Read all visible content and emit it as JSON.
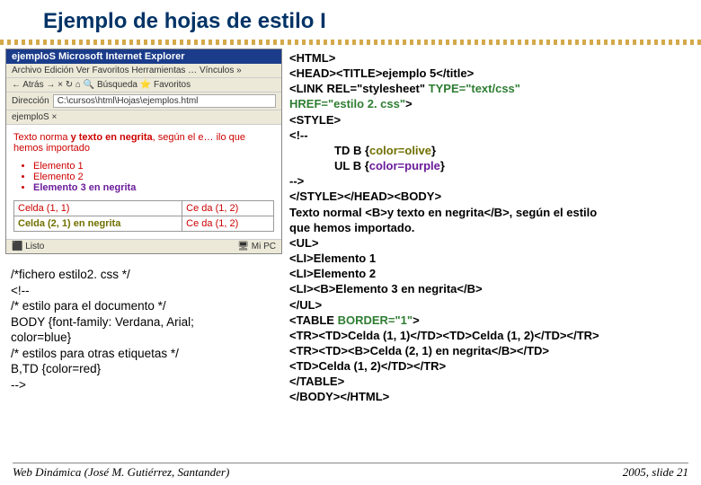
{
  "title": "Ejemplo de hojas de estilo I",
  "browser": {
    "titlebar": "ejemploS   Microsoft Internet Explorer",
    "menu": "Archivo   Edición   Ver   Favoritos   Herramientas   …   Vínculos  »",
    "toolbar": "← Atrás   →   ×   ↻   ⌂    🔍 Búsqueda   ⭐ Favoritos",
    "addr_label": "Dirección",
    "addr_value": "C:\\cursos\\html\\Hojas\\ejemplos.html",
    "tab": "ejemploS   ×",
    "body_text1": "Texto norma  ",
    "body_text2": "y texto en negrita",
    "body_text3": ", según el e… ilo  que hemos importado",
    "li1": "Elemento 1",
    "li2": "Elemento 2",
    "li3": "Elemento 3 en negrita",
    "c11": "Celda (1, 1)",
    "c12": "Ce da (1, 2)",
    "c21b": "Celda (2, 1) en negrita",
    "c22": "Ce da (1, 2)",
    "status_left": "⬛ Listo",
    "status_right": "🖥 Mi PC"
  },
  "css": {
    "l1": "/*fichero estilo2. css */",
    "l2": "<!--",
    "l3": "/* estilo para el documento */",
    "l4": "    BODY {font-family: Verdana, Arial;",
    "l5": "             color=blue}",
    "l6": "/* estilos para otras etiquetas */",
    "l7": "    B,TD {color=red}",
    "l8": "-->"
  },
  "code": {
    "l1": "<HTML>",
    "l2": "<HEAD><TITLE>ejemplo 5</title>",
    "l3a": "<LINK REL=\"stylesheet\" ",
    "l3b": "TYPE=\"text/css\"",
    "l4a": "HREF=\"estilo 2. css\"",
    "l4b": ">",
    "l5": "<STYLE>",
    "l6": "<!--",
    "l7a": "TD B {",
    "l7b": "color=olive",
    "l7c": "}",
    "l8a": "UL B {",
    "l8b": "color=purple",
    "l8c": "}",
    "l9": "-->",
    "l10": "</STYLE></HEAD><BODY>",
    "l11": "Texto normal <B>y texto en negrita</B>, según el estilo",
    "l12": "que hemos importado.",
    "l13": "<UL>",
    "l14": "<LI>Elemento 1",
    "l15": "<LI>Elemento 2",
    "l16": "<LI><B>Elemento 3 en negrita</B>",
    "l17": "</UL>",
    "l18a": "<TABLE ",
    "l18b": "BORDER=\"1\"",
    "l18c": ">",
    "l19": "<TR><TD>Celda (1, 1)</TD><TD>Celda (1, 2)</TD></TR>",
    "l20": "<TR><TD><B>Celda (2, 1) en negrita</B></TD>",
    "l21": "<TD>Celda (1, 2)</TD></TR>",
    "l22": "</TABLE>",
    "l23": "</BODY></HTML>"
  },
  "footer_left": "Web Dinámica (José M. Gutiérrez, Santander)",
  "footer_right": "2005, slide 21"
}
